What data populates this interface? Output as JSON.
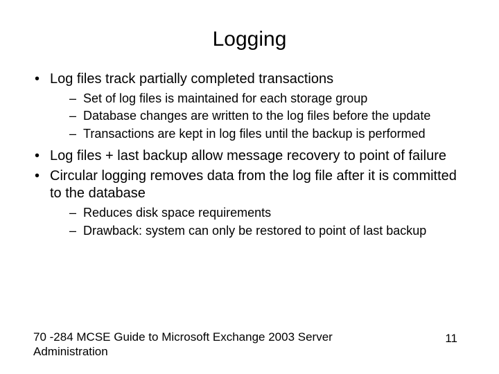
{
  "title": "Logging",
  "b1": "Log files track partially completed transactions",
  "b1s1": "Set of log files is maintained for each storage group",
  "b1s2": "Database changes are written to the log files before the update",
  "b1s3": "Transactions are kept in log files until the backup is performed",
  "b2": "Log files + last backup allow message recovery to point of failure",
  "b3": "Circular logging removes data from the log file after it is committed to the database",
  "b3s1": "Reduces disk space requirements",
  "b3s2": "Drawback: system can only be restored to point of last backup",
  "footer_source": "70 -284 MCSE Guide to Microsoft Exchange 2003 Server Administration",
  "page_number": "11"
}
